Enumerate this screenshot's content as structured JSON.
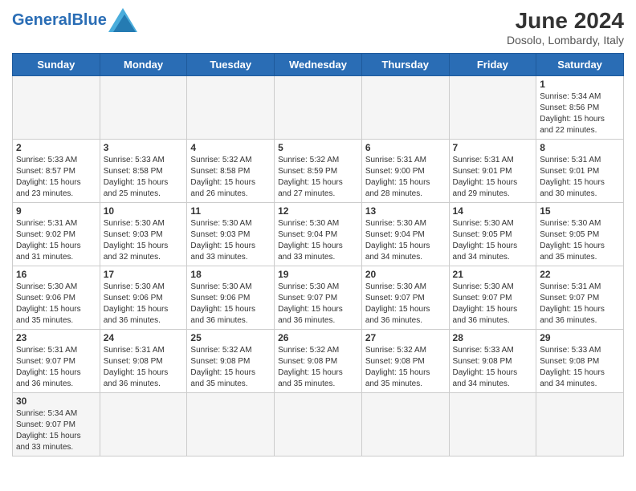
{
  "header": {
    "logo_general": "General",
    "logo_blue": "Blue",
    "month_title": "June 2024",
    "subtitle": "Dosolo, Lombardy, Italy"
  },
  "weekdays": [
    "Sunday",
    "Monday",
    "Tuesday",
    "Wednesday",
    "Thursday",
    "Friday",
    "Saturday"
  ],
  "days": [
    {
      "date": "",
      "info": ""
    },
    {
      "date": "",
      "info": ""
    },
    {
      "date": "",
      "info": ""
    },
    {
      "date": "",
      "info": ""
    },
    {
      "date": "",
      "info": ""
    },
    {
      "date": "",
      "info": ""
    },
    {
      "date": "1",
      "info": "Sunrise: 5:34 AM\nSunset: 8:56 PM\nDaylight: 15 hours and 22 minutes."
    },
    {
      "date": "2",
      "info": "Sunrise: 5:33 AM\nSunset: 8:57 PM\nDaylight: 15 hours and 23 minutes."
    },
    {
      "date": "3",
      "info": "Sunrise: 5:33 AM\nSunset: 8:58 PM\nDaylight: 15 hours and 25 minutes."
    },
    {
      "date": "4",
      "info": "Sunrise: 5:32 AM\nSunset: 8:58 PM\nDaylight: 15 hours and 26 minutes."
    },
    {
      "date": "5",
      "info": "Sunrise: 5:32 AM\nSunset: 8:59 PM\nDaylight: 15 hours and 27 minutes."
    },
    {
      "date": "6",
      "info": "Sunrise: 5:31 AM\nSunset: 9:00 PM\nDaylight: 15 hours and 28 minutes."
    },
    {
      "date": "7",
      "info": "Sunrise: 5:31 AM\nSunset: 9:01 PM\nDaylight: 15 hours and 29 minutes."
    },
    {
      "date": "8",
      "info": "Sunrise: 5:31 AM\nSunset: 9:01 PM\nDaylight: 15 hours and 30 minutes."
    },
    {
      "date": "9",
      "info": "Sunrise: 5:31 AM\nSunset: 9:02 PM\nDaylight: 15 hours and 31 minutes."
    },
    {
      "date": "10",
      "info": "Sunrise: 5:30 AM\nSunset: 9:03 PM\nDaylight: 15 hours and 32 minutes."
    },
    {
      "date": "11",
      "info": "Sunrise: 5:30 AM\nSunset: 9:03 PM\nDaylight: 15 hours and 33 minutes."
    },
    {
      "date": "12",
      "info": "Sunrise: 5:30 AM\nSunset: 9:04 PM\nDaylight: 15 hours and 33 minutes."
    },
    {
      "date": "13",
      "info": "Sunrise: 5:30 AM\nSunset: 9:04 PM\nDaylight: 15 hours and 34 minutes."
    },
    {
      "date": "14",
      "info": "Sunrise: 5:30 AM\nSunset: 9:05 PM\nDaylight: 15 hours and 34 minutes."
    },
    {
      "date": "15",
      "info": "Sunrise: 5:30 AM\nSunset: 9:05 PM\nDaylight: 15 hours and 35 minutes."
    },
    {
      "date": "16",
      "info": "Sunrise: 5:30 AM\nSunset: 9:06 PM\nDaylight: 15 hours and 35 minutes."
    },
    {
      "date": "17",
      "info": "Sunrise: 5:30 AM\nSunset: 9:06 PM\nDaylight: 15 hours and 36 minutes."
    },
    {
      "date": "18",
      "info": "Sunrise: 5:30 AM\nSunset: 9:06 PM\nDaylight: 15 hours and 36 minutes."
    },
    {
      "date": "19",
      "info": "Sunrise: 5:30 AM\nSunset: 9:07 PM\nDaylight: 15 hours and 36 minutes."
    },
    {
      "date": "20",
      "info": "Sunrise: 5:30 AM\nSunset: 9:07 PM\nDaylight: 15 hours and 36 minutes."
    },
    {
      "date": "21",
      "info": "Sunrise: 5:30 AM\nSunset: 9:07 PM\nDaylight: 15 hours and 36 minutes."
    },
    {
      "date": "22",
      "info": "Sunrise: 5:31 AM\nSunset: 9:07 PM\nDaylight: 15 hours and 36 minutes."
    },
    {
      "date": "23",
      "info": "Sunrise: 5:31 AM\nSunset: 9:07 PM\nDaylight: 15 hours and 36 minutes."
    },
    {
      "date": "24",
      "info": "Sunrise: 5:31 AM\nSunset: 9:08 PM\nDaylight: 15 hours and 36 minutes."
    },
    {
      "date": "25",
      "info": "Sunrise: 5:32 AM\nSunset: 9:08 PM\nDaylight: 15 hours and 35 minutes."
    },
    {
      "date": "26",
      "info": "Sunrise: 5:32 AM\nSunset: 9:08 PM\nDaylight: 15 hours and 35 minutes."
    },
    {
      "date": "27",
      "info": "Sunrise: 5:32 AM\nSunset: 9:08 PM\nDaylight: 15 hours and 35 minutes."
    },
    {
      "date": "28",
      "info": "Sunrise: 5:33 AM\nSunset: 9:08 PM\nDaylight: 15 hours and 34 minutes."
    },
    {
      "date": "29",
      "info": "Sunrise: 5:33 AM\nSunset: 9:08 PM\nDaylight: 15 hours and 34 minutes."
    },
    {
      "date": "30",
      "info": "Sunrise: 5:34 AM\nSunset: 9:07 PM\nDaylight: 15 hours and 33 minutes."
    },
    {
      "date": "",
      "info": ""
    },
    {
      "date": "",
      "info": ""
    },
    {
      "date": "",
      "info": ""
    },
    {
      "date": "",
      "info": ""
    },
    {
      "date": "",
      "info": ""
    },
    {
      "date": "",
      "info": ""
    }
  ]
}
